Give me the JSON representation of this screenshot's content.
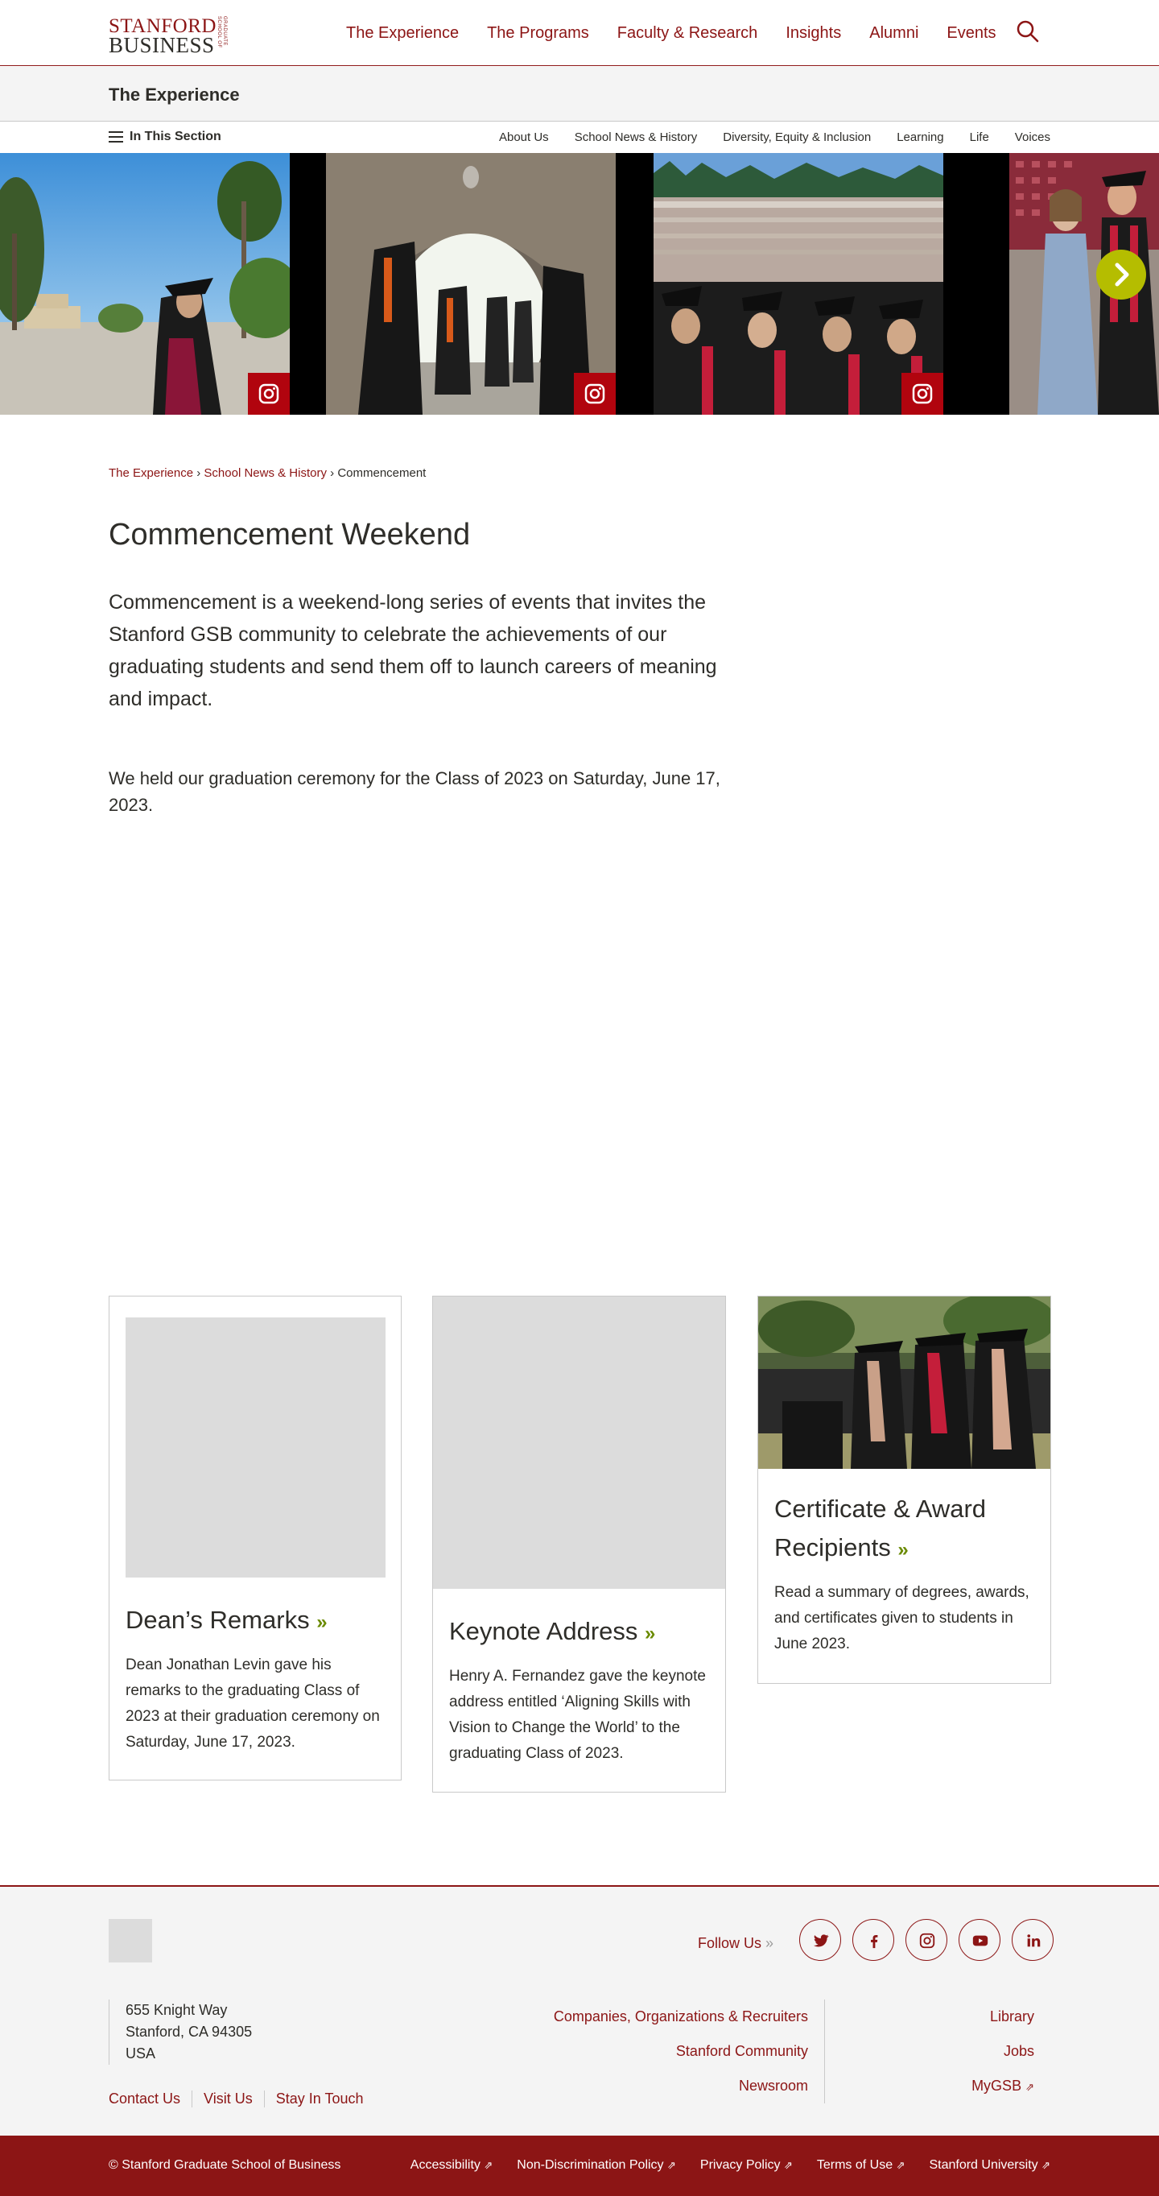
{
  "header": {
    "logo_line1": "STANFORD",
    "logo_line2": "BUSINESS",
    "logo_line3": "GRADUATE SCHOOL OF",
    "nav": [
      "The Experience",
      "The Programs",
      "Faculty & Research",
      "Insights",
      "Alumni",
      "Events"
    ],
    "search_icon": "search-icon"
  },
  "section": {
    "title": "The Experience",
    "menu_label": "In This Section",
    "links": [
      "About Us",
      "School News & History",
      "Diversity, Equity & Inclusion",
      "Learning",
      "Life",
      "Voices"
    ]
  },
  "gallery": {
    "badge_icon": "instagram-icon",
    "next_icon": "chevron-right-icon"
  },
  "breadcrumb": {
    "items": [
      "The Experience",
      "School News & History"
    ],
    "current": "Commencement",
    "separator": "›"
  },
  "main": {
    "title": "Commencement Weekend",
    "lead": "Commencement is a weekend-long series of events that invites the Stanford GSB community to celebrate the achievements of our graduating students and send them off to launch careers of meaning and impact.",
    "paragraph": "We held our graduation ceremony for the Class of 2023 on Saturday, June 17, 2023."
  },
  "cards": [
    {
      "title": "Dean’s Remarks",
      "description": "Dean Jonathan Levin gave his remarks to the graduating Class of 2023 at their graduation ceremony on Saturday, June 17, 2023."
    },
    {
      "title": "Keynote Address",
      "description": "Henry A. Fernandez gave the keynote address entitled ‘Aligning Skills with Vision to Change the World’ to the graduating Class of 2023."
    },
    {
      "title": "Certificate & Award Recipients",
      "description": "Read a summary of degrees, awards, and certificates given to students in June 2023."
    }
  ],
  "footer": {
    "follow_label": "Follow Us",
    "socials": [
      "twitter-icon",
      "facebook-icon",
      "instagram-icon",
      "youtube-icon",
      "linkedin-icon"
    ],
    "address": [
      "655 Knight Way",
      "Stanford, CA 94305",
      "USA"
    ],
    "links": [
      "Contact Us",
      "Visit Us",
      "Stay In Touch"
    ],
    "col1": [
      "Companies, Organizations & Recruiters",
      "Stanford Community",
      "Newsroom"
    ],
    "col2": [
      "Library",
      "Jobs",
      "MyGSB"
    ],
    "copyright": "© Stanford Graduate School of Business",
    "legal": [
      "Accessibility",
      "Non-Discrimination Policy",
      "Privacy Policy",
      "Terms of Use",
      "Stanford University"
    ]
  },
  "colors": {
    "brand_red": "#8c1515",
    "accent_green": "#b5bd00",
    "footer_bg": "#f4f4f4"
  }
}
